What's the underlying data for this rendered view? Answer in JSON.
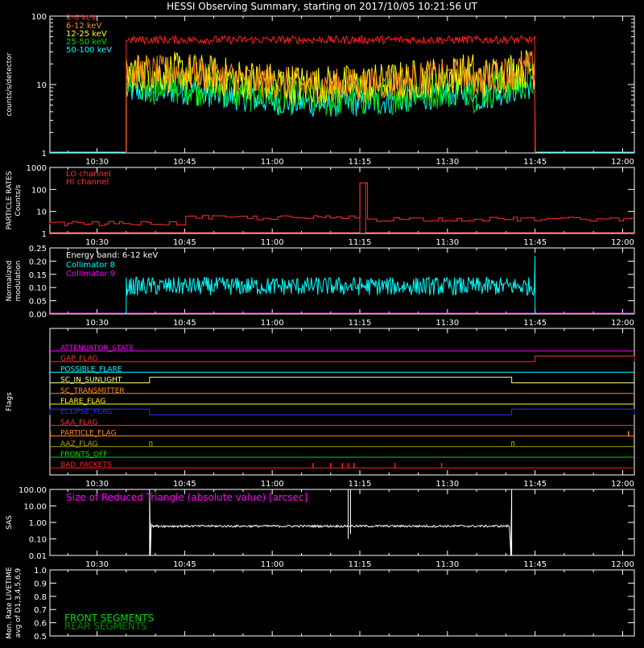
{
  "title": "HESSI Observing Summary, starting on 2017/10/05 10:21:56 UT",
  "time_axis": {
    "start": "10:21:56",
    "end": "12:02:00",
    "ticks": [
      "10:30",
      "10:45",
      "11:00",
      "11:15",
      "11:30",
      "11:45",
      "12:00"
    ]
  },
  "chart_data": [
    {
      "type": "line",
      "id": "count-rates",
      "ylabel": "counts/s/detector",
      "yscale": "log",
      "ylim": [
        1,
        100
      ],
      "yticks": [
        "1",
        "10",
        "100"
      ],
      "legend_position": "top-left",
      "series": [
        {
          "name": "3-6 keV",
          "color": "#ff2020",
          "x_start": "10:35",
          "x_end": "11:45",
          "level": 45,
          "noise": 0.06,
          "profile": "flat"
        },
        {
          "name": "6-12 keV",
          "color": "#ff8c1a",
          "x_start": "10:35",
          "x_end": "11:45",
          "level": 15,
          "noise": 0.25,
          "profile": "dip"
        },
        {
          "name": "12-25 keV",
          "color": "#ffff00",
          "x_start": "10:35",
          "x_end": "11:45",
          "level": 15,
          "noise": 0.3,
          "profile": "dip"
        },
        {
          "name": "25-50 keV",
          "color": "#00dd00",
          "x_start": "10:35",
          "x_end": "11:45",
          "level": 10,
          "noise": 0.3,
          "profile": "dip"
        },
        {
          "name": "50-100 keV",
          "color": "#00ffff",
          "x_start": "10:35",
          "x_end": "11:45",
          "level": 8,
          "noise": 0.2,
          "profile": "dip"
        }
      ]
    },
    {
      "type": "line",
      "id": "particle-rates",
      "ylabel_lines": [
        "PARTICLE RATES",
        "Counts/s"
      ],
      "yscale": "log",
      "ylim": [
        1,
        1000
      ],
      "yticks": [
        "1",
        "10",
        "100",
        "1000"
      ],
      "legend_position": "top-left",
      "series": [
        {
          "name": "LO channel",
          "color": "#ff3030",
          "level": 4,
          "spike": {
            "start": "11:15",
            "end": "11:16",
            "value": 200
          }
        },
        {
          "name": "HI channel",
          "color": "#ff3030",
          "level": 1,
          "spike": {
            "start": "11:15",
            "end": "11:16",
            "value": 200
          }
        }
      ]
    },
    {
      "type": "line",
      "id": "modulation",
      "ylabel_lines": [
        "Normalized",
        "modulation"
      ],
      "ylim": [
        0,
        0.25
      ],
      "yticks": [
        "0.00",
        "0.05",
        "0.10",
        "0.15",
        "0.20",
        "0.25"
      ],
      "legend_title": "Energy band: 6-12 keV",
      "series": [
        {
          "name": "Collimator 8",
          "color": "#00ffff",
          "x_start": "10:35",
          "x_end": "11:45",
          "level": 0.105
        },
        {
          "name": "Collimator 9",
          "color": "#ff00ff",
          "level": 0.0
        }
      ]
    },
    {
      "type": "line",
      "id": "flags",
      "ylabel": "Flags",
      "flags": [
        {
          "name": "ATTENUATOR_STATE",
          "color": "#ff00ff",
          "high": []
        },
        {
          "name": "GAP_FLAG",
          "color": "#ff3030",
          "high": [
            [
              "11:45",
              "12:02"
            ]
          ]
        },
        {
          "name": "POSSIBLE_FLARE",
          "color": "#00ffff",
          "high": []
        },
        {
          "name": "SC_IN_SUNLIGHT",
          "color": "#ffff80",
          "high": [
            [
              "10:39",
              "11:41"
            ]
          ]
        },
        {
          "name": "SC_TRANSMITTER",
          "color": "#ff8c1a",
          "high": []
        },
        {
          "name": "FLARE_FLAG",
          "color": "#ffff00",
          "high": []
        },
        {
          "name": "ECLIPSE_FLAG",
          "color": "#3030ff",
          "high": [
            [
              "10:21",
              "10:39"
            ],
            [
              "11:41",
              "12:02"
            ]
          ]
        },
        {
          "name": "SAA_FLAG",
          "color": "#ff3030",
          "high": []
        },
        {
          "name": "PARTICLE_FLAG",
          "color": "#ff8c1a",
          "high": []
        },
        {
          "name": "AAZ_FLAG",
          "color": "#b0a000",
          "high": []
        },
        {
          "name": "FRONTS_OFF",
          "color": "#00dd00",
          "high": []
        },
        {
          "name": "BAD_PACKETS",
          "color": "#ff2020",
          "high": []
        }
      ],
      "aaz_spikes": [
        "10:39",
        "11:41"
      ],
      "bad_packet_spikes": [
        "11:07",
        "11:10",
        "11:12",
        "11:13",
        "11:14",
        "11:21",
        "11:29"
      ],
      "particle_edges": [
        "10:22",
        "12:01"
      ]
    },
    {
      "type": "line",
      "id": "sas",
      "ylabel": "SAS",
      "yscale": "log",
      "ylim": [
        0.01,
        100
      ],
      "yticks": [
        "0.01",
        "0.10",
        "1.00",
        "10.00",
        "100.00"
      ],
      "annotation": "Size of Reduced Triangle (absolute value) [arcsec]",
      "annotation_color": "#ff00ff",
      "series": [
        {
          "name": "",
          "color": "#ffffff",
          "x_start": "10:39",
          "x_end": "11:41",
          "level": 0.6
        }
      ]
    },
    {
      "type": "line",
      "id": "livetime",
      "ylabel_lines": [
        "Mon. Rate LIVETIME",
        "avg of D1,3,4,5,6,9"
      ],
      "ylim": [
        0.5,
        1.0
      ],
      "yticks": [
        "0.5",
        "0.6",
        "0.7",
        "0.8",
        "0.9",
        "1.0"
      ],
      "legend_position": "bottom-left",
      "series": [
        {
          "name": "FRONT SEGMENTS",
          "color": "#00dd00"
        },
        {
          "name": "REAR SEGMENTS",
          "color": "#008800"
        }
      ]
    }
  ]
}
